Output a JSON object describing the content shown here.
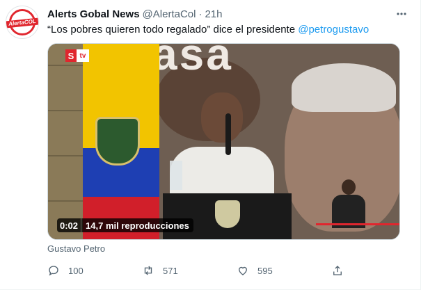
{
  "tweet": {
    "author_name": "Alerts Gobal News",
    "handle": "@AlertaCol",
    "separator": "·",
    "time": "21h",
    "text_before_mention": "“Los pobres quieren todo regalado” dice el presidente ",
    "mention": "@petrogustavo",
    "avatar_logo_text": "AlertaCOL"
  },
  "media": {
    "duration": "0:02",
    "views": "14,7 mil reproducciones",
    "channel_logo_s": "S",
    "channel_logo_tv": "tv",
    "poster_text": "asa",
    "caption": "Gustavo Petro"
  },
  "actions": {
    "replies": "100",
    "retweets": "571",
    "likes": "595"
  },
  "icons": {
    "more": "more-dots-icon",
    "reply": "reply-icon",
    "retweet": "retweet-icon",
    "like": "heart-icon",
    "share": "share-icon"
  },
  "colors": {
    "accent": "#1d9bf0",
    "text": "#0f1419",
    "muted": "#536471",
    "brand_red": "#e0262e"
  }
}
